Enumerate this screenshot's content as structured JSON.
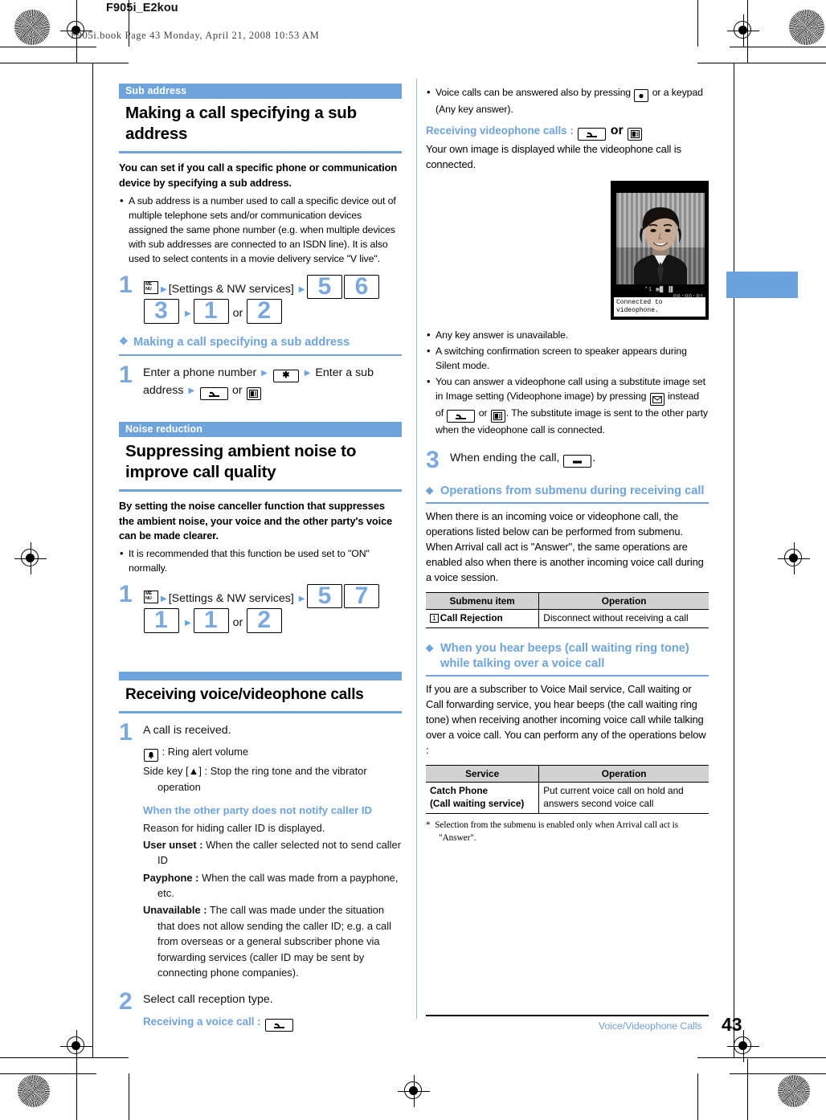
{
  "header": {
    "book_title": "F905i_E2kou",
    "book_line": "F905i.book  Page 43  Monday, April 21, 2008  10:53 AM"
  },
  "footer": {
    "section": "Voice/Videophone Calls",
    "page_number": "43"
  },
  "colors": {
    "accent_blue": "#6fa3dc",
    "step_number_blue": "#7ba9dd",
    "table_header_gray": "#d2d2d2"
  },
  "left_column": {
    "section1": {
      "kicker": "Sub address",
      "title": "Making a call specifying a sub address",
      "lead": "You can set if you call a specific phone or communication device by specifying a sub address.",
      "bullets": [
        "A sub address is a number used to call a specific device out of multiple telephone sets and/or communication devices assigned the same phone number (e.g. when multiple devices with sub addresses are connected to an ISDN line). It is also used to select contents in a movie delivery service \"V live\"."
      ],
      "step1": {
        "number": "1",
        "menu_key": "MENU",
        "label": "[Settings & NW services]",
        "keys": [
          "5",
          "6",
          "3"
        ],
        "keys2": [
          "1",
          "2"
        ],
        "or_text": "or"
      },
      "subhead": "Making a call specifying a sub address",
      "step2": {
        "number": "1",
        "text_a": "Enter a phone number",
        "text_b": "Enter a sub address",
        "or_text": "or",
        "star_key": "✶"
      }
    },
    "section2": {
      "kicker": "Noise reduction",
      "title": "Suppressing ambient noise to improve call quality",
      "lead": "By setting the noise canceller function that suppresses the ambient noise, your voice and the other party's voice can be made clearer.",
      "bullets": [
        "It is recommended that this function be used set to \"ON\" normally."
      ],
      "step1": {
        "number": "1",
        "menu_key": "MENU",
        "label": "[Settings & NW services]",
        "keys": [
          "5",
          "7",
          "1"
        ],
        "keys2": [
          "1",
          "2"
        ],
        "or_text": "or"
      }
    },
    "section3": {
      "title": "Receiving voice/videophone calls",
      "step1": {
        "number": "1",
        "text": "A call is received.",
        "line_ring": ": Ring alert volume",
        "line_side": "Side key [▲] : Stop the ring tone and the vibrator operation"
      },
      "caller_id_head": "When the other party does not notify caller ID",
      "caller_id_intro": "Reason for hiding caller ID is displayed.",
      "caller_id_items": [
        {
          "term": "User unset :",
          "desc": "When the caller selected not to send caller ID"
        },
        {
          "term": "Payphone :",
          "desc": "When the call was made from a payphone, etc."
        },
        {
          "term": "Unavailable :",
          "desc": "The call was made under the situation that does not allow sending the caller ID; e.g. a call from overseas or a general subscriber phone via forwarding services (caller ID may be sent by connecting phone companies)."
        }
      ],
      "step2": {
        "number": "2",
        "text": "Select call reception type.",
        "voice_label": "Receiving a voice call :"
      }
    }
  },
  "right_column": {
    "top_bullets": [
      "Voice calls can be answered also by pressing ◉ or a keypad (Any key answer)."
    ],
    "videophone_label": "Receiving videophone calls :",
    "videophone_or": "or",
    "videophone_desc": "Your own image is displayed while the videophone call is connected.",
    "phone_screen": {
      "status": "*1",
      "timer": "00:00:01",
      "message_line1": "Connected to",
      "message_line2": "videophone."
    },
    "bullets2": [
      "Any key answer is unavailable.",
      "A switching confirmation screen to speaker appears during Silent mode.",
      "You can answer a videophone call using a substitute image set in Image setting (Videophone image) by pressing ✉ instead of 📞 or 🎦. The substitute image is sent to the other party when the videophone call is connected."
    ],
    "bullet3_parts": {
      "a": "You can answer a videophone call using a substitute image set in Image setting (Videophone image) by pressing",
      "b": "instead of",
      "c": "or",
      "d": ". The substitute image is sent to the other party when the videophone call is connected."
    },
    "step3": {
      "number": "3",
      "text": "When ending the call,",
      "trailing": "."
    },
    "submenu_head": "Operations from submenu during receiving call",
    "submenu_body": "When there is an incoming voice or videophone call, the operations listed below can be performed from submenu. When Arrival call act is \"Answer\", the same operations are enabled also when there is another incoming voice call during a voice session.",
    "submenu_table": {
      "headers": [
        "Submenu item",
        "Operation"
      ],
      "rows": [
        {
          "key": "1",
          "item": "Call Rejection",
          "operation": "Disconnect without receiving a call"
        }
      ]
    },
    "beeps_head": "When you hear beeps (call waiting ring tone) while talking over a voice call",
    "beeps_body": "If you are a subscriber to Voice Mail service, Call waiting or Call forwarding service, you hear beeps (the call waiting ring tone) when receiving another incoming voice call while talking over a voice call. You can perform any of the operations below :",
    "service_table": {
      "headers": [
        "Service",
        "Operation"
      ],
      "rows": [
        {
          "service_l1": "Catch Phone",
          "service_l2": "(Call waiting service)",
          "operation": "Put current voice call on hold and answers second voice call"
        }
      ]
    },
    "footnote": "Selection from the submenu is enabled only when Arrival call act is \"Answer\".",
    "footnote_marker": "*"
  }
}
